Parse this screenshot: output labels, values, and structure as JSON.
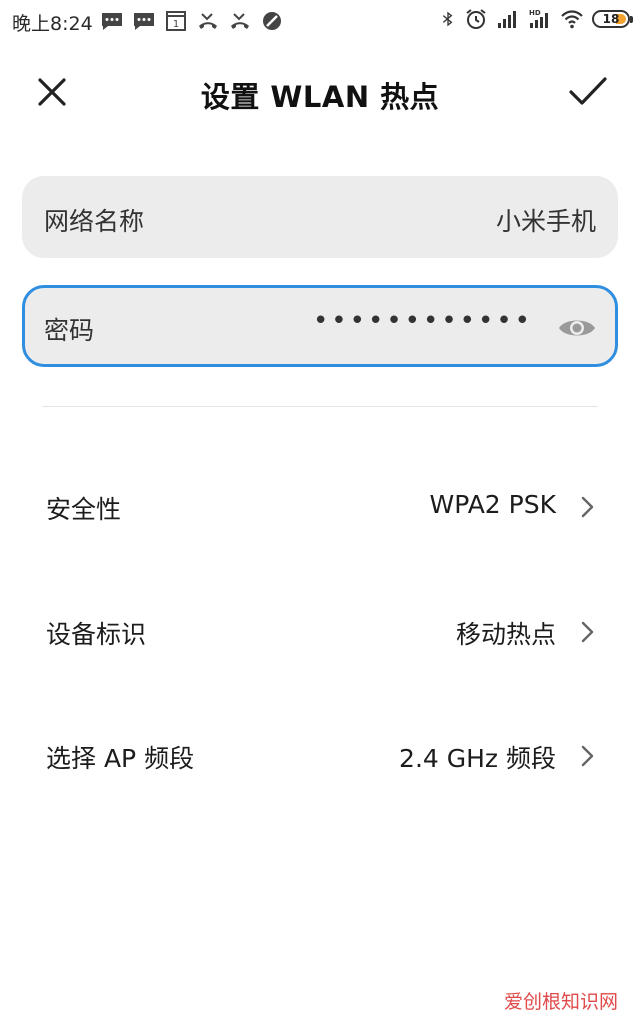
{
  "status_bar": {
    "time": "晚上8:24",
    "battery_level": "18",
    "icons_left": [
      "message-icon",
      "message-icon",
      "calendar-icon",
      "missed-call-icon",
      "missed-call-icon",
      "dnd-icon"
    ],
    "icons_right": [
      "bluetooth-icon",
      "alarm-icon",
      "signal-icon",
      "hd-signal-icon",
      "wifi-icon",
      "battery-icon"
    ]
  },
  "header": {
    "title": "设置 WLAN 热点"
  },
  "network_name": {
    "label": "网络名称",
    "value": "小米手机"
  },
  "password": {
    "label": "密码",
    "masked_value": "••••••••••••"
  },
  "settings": {
    "security": {
      "label": "安全性",
      "value": "WPA2 PSK"
    },
    "device_id": {
      "label": "设备标识",
      "value": "移动热点"
    },
    "ap_band": {
      "label": "选择 AP 频段",
      "value": "2.4 GHz 频段"
    }
  },
  "watermark": "爱创根知识网",
  "colors": {
    "accent": "#2f8ee0",
    "field_bg": "#ececec",
    "battery": "#f2a330",
    "watermark": "#e04a4a"
  }
}
